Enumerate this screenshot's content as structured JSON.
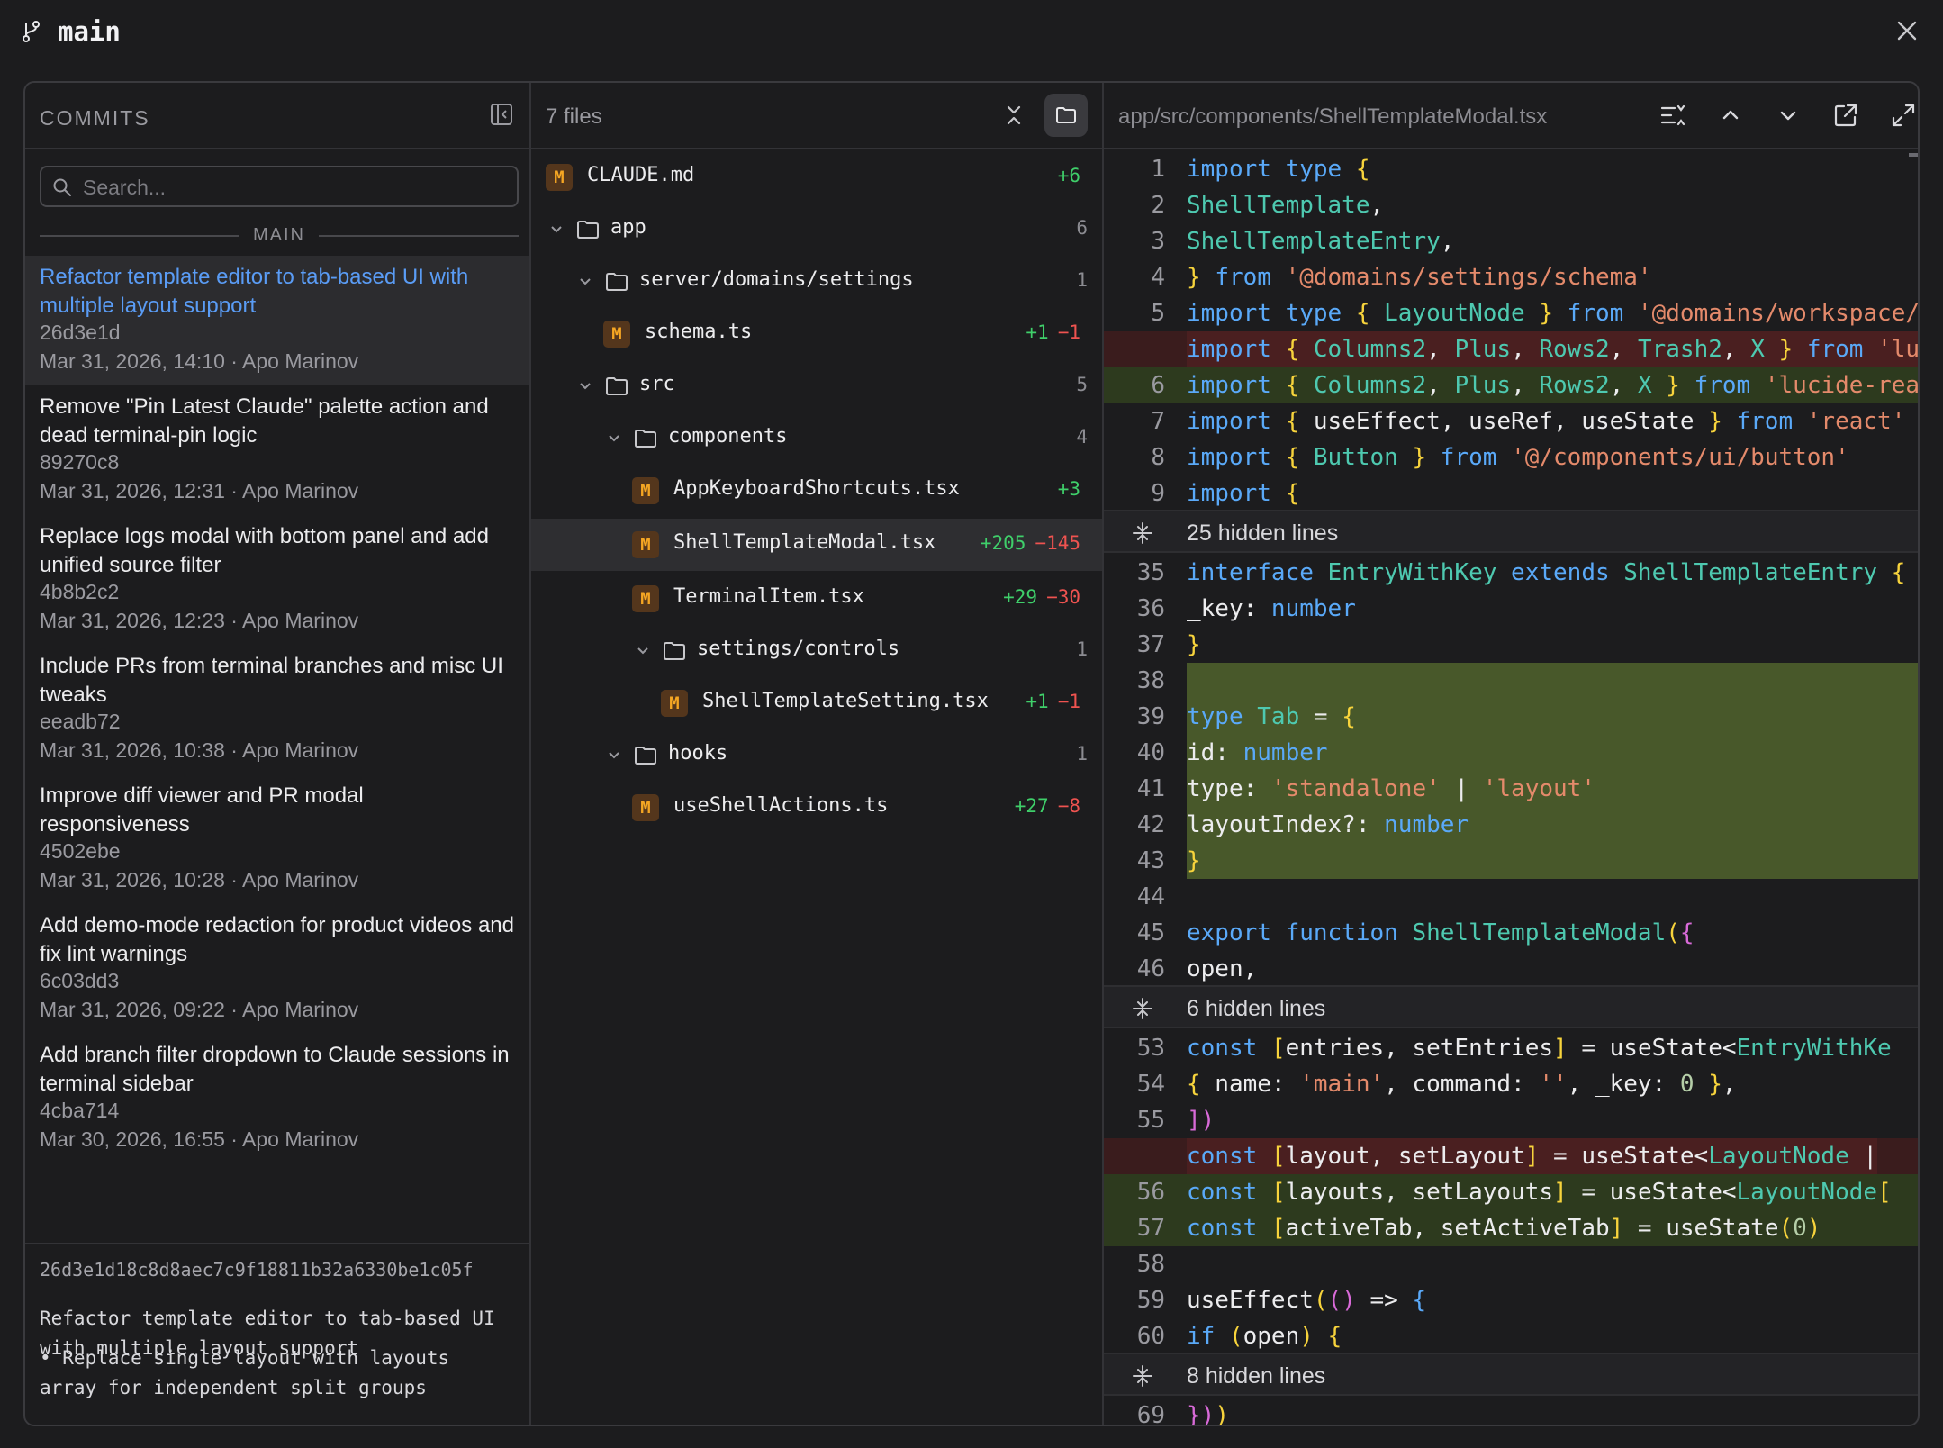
{
  "window": {
    "branch": "main"
  },
  "commits": {
    "title": "COMMITS",
    "search_placeholder": "Search...",
    "branch_label": "MAIN",
    "items": [
      {
        "message": "Refactor template editor to tab-based UI with multiple layout support",
        "hash": "26d3e1d",
        "meta": "Mar 31, 2026, 14:10 · Apo Marinov"
      },
      {
        "message": "Remove \"Pin Latest Claude\" palette action and dead terminal-pin logic",
        "hash": "89270c8",
        "meta": "Mar 31, 2026, 12:31 · Apo Marinov"
      },
      {
        "message": "Replace logs modal with bottom panel and add unified source filter",
        "hash": "4b8b2c2",
        "meta": "Mar 31, 2026, 12:23 · Apo Marinov"
      },
      {
        "message": "Include PRs from terminal branches and misc UI tweaks",
        "hash": "eeadb72",
        "meta": "Mar 31, 2026, 10:38 · Apo Marinov"
      },
      {
        "message": "Improve diff viewer and PR modal responsiveness",
        "hash": "4502ebe",
        "meta": "Mar 31, 2026, 10:28 · Apo Marinov"
      },
      {
        "message": "Add demo-mode redaction for product videos and fix lint warnings",
        "hash": "6c03dd3",
        "meta": "Mar 31, 2026, 09:22 · Apo Marinov"
      },
      {
        "message": "Add branch filter dropdown to Claude sessions in terminal sidebar",
        "hash": "4cba714",
        "meta": "Mar 30, 2026, 16:55 · Apo Marinov"
      }
    ],
    "detail": {
      "full_hash": "26d3e1d18c8d8aec7c9f18811b32a6330be1c05f",
      "subject": "Refactor template editor to tab-based UI with multiple layout support",
      "body": "•  Replace single layout with layouts array for independent split groups"
    }
  },
  "files": {
    "count_label": "7 files",
    "rows": [
      {
        "kind": "file",
        "badge": "M",
        "name": "CLAUDE.md",
        "add": "+6",
        "del": ""
      },
      {
        "kind": "folder",
        "name": "app",
        "count": "6"
      },
      {
        "kind": "folder",
        "name": "server/domains/settings",
        "count": "1"
      },
      {
        "kind": "file",
        "badge": "M",
        "name": "schema.ts",
        "add": "+1",
        "del": "−1"
      },
      {
        "kind": "folder",
        "name": "src",
        "count": "5"
      },
      {
        "kind": "folder",
        "name": "components",
        "count": "4"
      },
      {
        "kind": "file",
        "badge": "M",
        "name": "AppKeyboardShortcuts.tsx",
        "add": "+3",
        "del": ""
      },
      {
        "kind": "file",
        "badge": "M",
        "name": "ShellTemplateModal.tsx",
        "add": "+205",
        "del": "−145"
      },
      {
        "kind": "file",
        "badge": "M",
        "name": "TerminalItem.tsx",
        "add": "+29",
        "del": "−30"
      },
      {
        "kind": "folder",
        "name": "settings/controls",
        "count": "1"
      },
      {
        "kind": "file",
        "badge": "M",
        "name": "ShellTemplateSetting.tsx",
        "add": "+1",
        "del": "−1"
      },
      {
        "kind": "folder",
        "name": "hooks",
        "count": "1"
      },
      {
        "kind": "file",
        "badge": "M",
        "name": "useShellActions.ts",
        "add": "+27",
        "del": "−8"
      }
    ]
  },
  "diff": {
    "path": "app/src/components/ShellTemplateModal.tsx",
    "hidden": [
      "25 hidden lines",
      "6 hidden lines",
      "8 hidden lines"
    ],
    "line_numbers": [
      "1",
      "2",
      "3",
      "4",
      "5",
      "6",
      "7",
      "8",
      "9",
      "35",
      "36",
      "37",
      "38",
      "39",
      "40",
      "41",
      "42",
      "43",
      "44",
      "45",
      "46",
      "53",
      "54",
      "55",
      "56",
      "57",
      "58",
      "59",
      "60",
      "69"
    ]
  },
  "colors": {
    "accent": "#5a9cf5",
    "added": "#3fcf6a",
    "removed": "#ef5350",
    "modified": "#f5a623"
  }
}
